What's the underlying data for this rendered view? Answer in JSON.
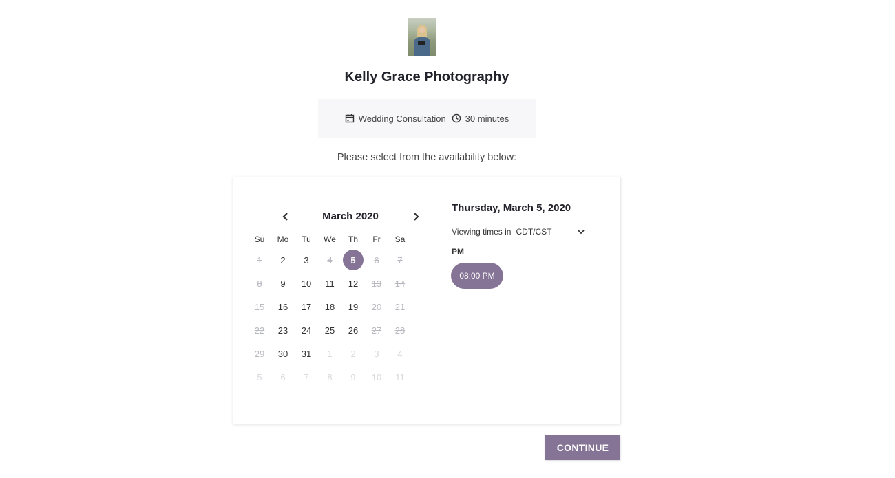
{
  "business": {
    "name": "Kelly Grace Photography"
  },
  "appointment": {
    "type": "Wedding Consultation",
    "duration": "30 minutes"
  },
  "prompt": "Please select from the availability below:",
  "calendar": {
    "month_label": "March 2020",
    "weekdays": [
      "Su",
      "Mo",
      "Tu",
      "We",
      "Th",
      "Fr",
      "Sa"
    ],
    "weeks": [
      [
        {
          "d": "1",
          "s": "struck"
        },
        {
          "d": "2",
          "s": "available"
        },
        {
          "d": "3",
          "s": "available"
        },
        {
          "d": "4",
          "s": "struck"
        },
        {
          "d": "5",
          "s": "selected"
        },
        {
          "d": "6",
          "s": "struck"
        },
        {
          "d": "7",
          "s": "struck"
        }
      ],
      [
        {
          "d": "8",
          "s": "struck"
        },
        {
          "d": "9",
          "s": "available"
        },
        {
          "d": "10",
          "s": "available"
        },
        {
          "d": "11",
          "s": "available"
        },
        {
          "d": "12",
          "s": "available"
        },
        {
          "d": "13",
          "s": "struck"
        },
        {
          "d": "14",
          "s": "struck"
        }
      ],
      [
        {
          "d": "15",
          "s": "struck"
        },
        {
          "d": "16",
          "s": "available"
        },
        {
          "d": "17",
          "s": "available"
        },
        {
          "d": "18",
          "s": "available"
        },
        {
          "d": "19",
          "s": "available"
        },
        {
          "d": "20",
          "s": "struck"
        },
        {
          "d": "21",
          "s": "struck"
        }
      ],
      [
        {
          "d": "22",
          "s": "struck"
        },
        {
          "d": "23",
          "s": "available"
        },
        {
          "d": "24",
          "s": "available"
        },
        {
          "d": "25",
          "s": "available"
        },
        {
          "d": "26",
          "s": "available"
        },
        {
          "d": "27",
          "s": "struck"
        },
        {
          "d": "28",
          "s": "struck"
        }
      ],
      [
        {
          "d": "29",
          "s": "struck"
        },
        {
          "d": "30",
          "s": "available"
        },
        {
          "d": "31",
          "s": "available"
        },
        {
          "d": "1",
          "s": "faded"
        },
        {
          "d": "2",
          "s": "faded"
        },
        {
          "d": "3",
          "s": "faded"
        },
        {
          "d": "4",
          "s": "faded"
        }
      ],
      [
        {
          "d": "5",
          "s": "faded"
        },
        {
          "d": "6",
          "s": "faded"
        },
        {
          "d": "7",
          "s": "faded"
        },
        {
          "d": "8",
          "s": "faded"
        },
        {
          "d": "9",
          "s": "faded"
        },
        {
          "d": "10",
          "s": "faded"
        },
        {
          "d": "11",
          "s": "faded"
        }
      ]
    ]
  },
  "selection": {
    "date_label": "Thursday, March 5, 2020",
    "timezone_prefix": "Viewing times in",
    "timezone_value": "CDT/CST",
    "period": "PM",
    "slots": [
      "08:00 PM"
    ]
  },
  "actions": {
    "continue": "CONTINUE"
  },
  "colors": {
    "accent": "#857496",
    "muted": "#b9b9c1",
    "faded": "#d9d9de"
  },
  "icons": {
    "appointment": "calendar-icon",
    "duration": "clock-icon"
  }
}
